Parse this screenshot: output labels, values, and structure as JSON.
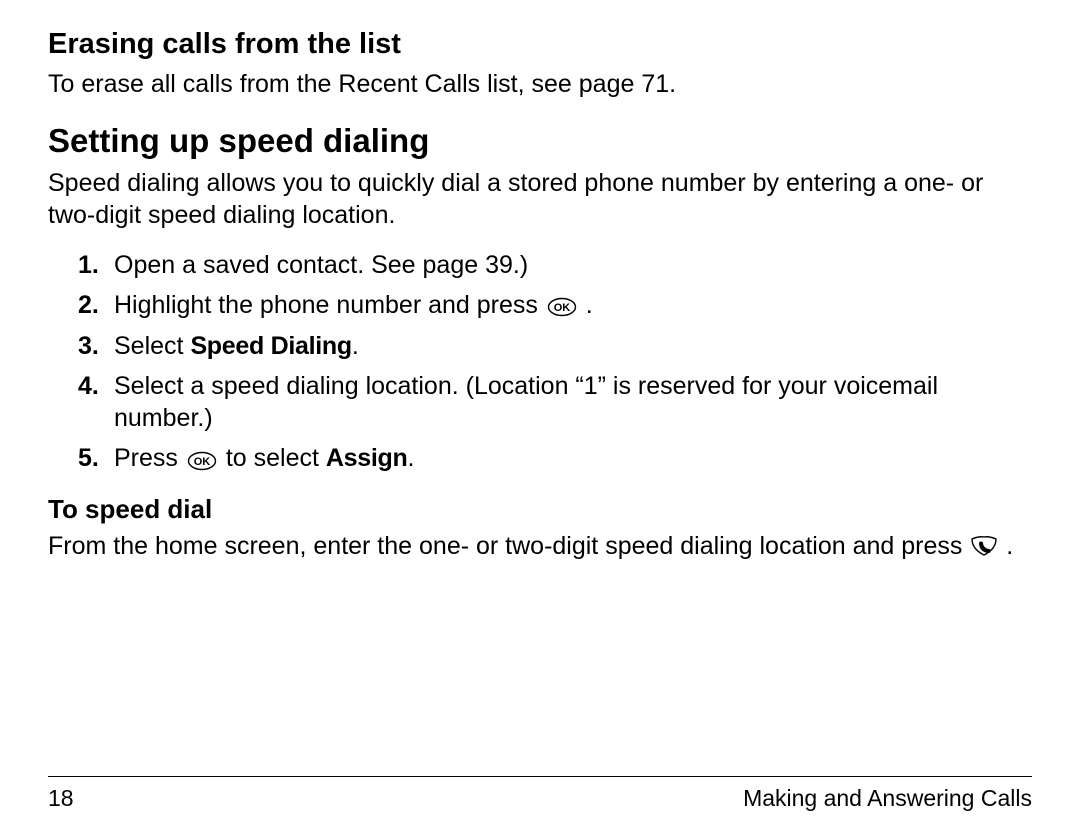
{
  "erase": {
    "heading": "Erasing calls from the list",
    "body": "To erase all calls from the Recent Calls list, see page 71."
  },
  "speed_dial": {
    "heading": "Setting up speed dialing",
    "intro": "Speed dialing allows you to quickly dial a stored phone number by entering a one- or two-digit speed dialing location.",
    "steps": {
      "s1_num": "1.",
      "s1_text": "Open a saved contact. See page 39.)",
      "s1_pre": "Open a saved contact. See page 39.)",
      "s1_full": "Open a saved contact. See page 39.)",
      "s1": "Open a saved contact. See page 39.)",
      "n1": "1.",
      "t1": "Open a saved contact. See page 39.)",
      "num2": "2.",
      "t2a": "Highlight the phone number and press ",
      "t2b": ".",
      "num3": "3.",
      "t3a": "Select ",
      "t3b": "Speed Dialing",
      "t3c": ".",
      "num4": "4.",
      "t4": "Select a speed dialing location. (Location \"1\" is reserved for your voicemail number.)",
      "num5": "5.",
      "t5a": "Press ",
      "t5b": " to select ",
      "t5c": "Assign",
      "t5d": "."
    },
    "step1_num": "1.",
    "step1_text": "Open a saved contact. See page 39.)"
  },
  "steps": {
    "n1": "1.",
    "t1": "Open a saved contact. See page 39.)",
    "n2": "2.",
    "t2a": "Highlight the phone number and press ",
    "t2b": ".",
    "n3": "3.",
    "t3a": "Select ",
    "t3b": "Speed Dialing",
    "t3c": ".",
    "n4": "4.",
    "t4": "Select a speed dialing location. (Location “1” is reserved for your voicemail number.)",
    "n5": "5.",
    "t5a": "Press ",
    "t5b": " to select ",
    "t5c": "Assign",
    "t5d": "."
  },
  "to_speed_dial": {
    "heading": "To speed dial",
    "body_a": "From the home screen, enter the one- or two-digit speed dialing location and press ",
    "body_b": "."
  },
  "footer": {
    "page": "18",
    "section": "Making and Answering Calls"
  }
}
